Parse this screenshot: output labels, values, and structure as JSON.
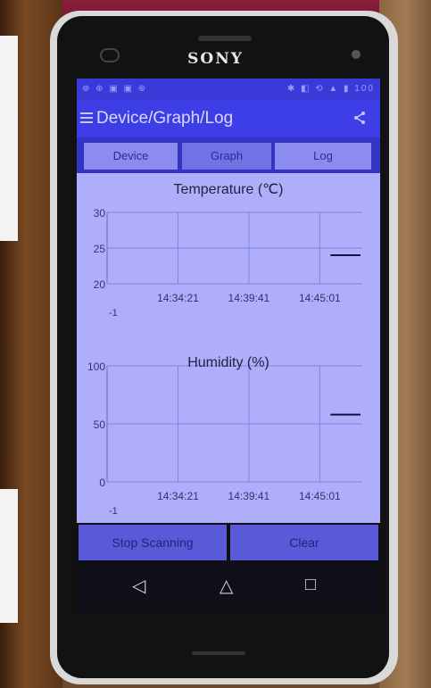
{
  "device": {
    "brand": "SONY"
  },
  "statusbar": {
    "left_icons": "⊕ ⊕ ▣ ▣ ⊕",
    "right_icons": "✱ ◧ ⟲ ▲ ▮ 100"
  },
  "app": {
    "title": "Device/Graph/Log"
  },
  "tabs": [
    {
      "label": "Device"
    },
    {
      "label": "Graph"
    },
    {
      "label": "Log"
    }
  ],
  "charts": {
    "temperature": {
      "title": "Temperature (℃)",
      "y_ticks": [
        "30",
        "25",
        "20"
      ],
      "x_ticks": [
        "14:34:21",
        "14:39:41",
        "14:45:01"
      ],
      "corner_label": "-1"
    },
    "humidity": {
      "title": "Humidity (%)",
      "y_ticks": [
        "100",
        "50",
        "0"
      ],
      "x_ticks": [
        "14:34:21",
        "14:39:41",
        "14:45:01"
      ],
      "corner_label": "-1"
    }
  },
  "chart_data": [
    {
      "type": "line",
      "title": "Temperature (℃)",
      "ylim": [
        20,
        30
      ],
      "x": [
        "14:34:21",
        "14:39:41",
        "14:45:01"
      ],
      "series": [
        {
          "values": [
            null,
            null,
            24
          ]
        }
      ]
    },
    {
      "type": "line",
      "title": "Humidity (%)",
      "ylim": [
        0,
        100
      ],
      "x": [
        "14:34:21",
        "14:39:41",
        "14:45:01"
      ],
      "series": [
        {
          "values": [
            null,
            null,
            58
          ]
        }
      ]
    }
  ],
  "buttons": {
    "stop": "Stop Scanning",
    "clear": "Clear"
  },
  "nav": {
    "back": "◁",
    "home": "△",
    "recents": "□"
  },
  "colors": {
    "line": "#10104a",
    "grid": "#8484dc",
    "accent": "#3e3ee6"
  }
}
